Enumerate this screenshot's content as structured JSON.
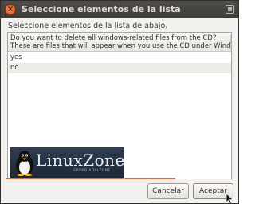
{
  "window": {
    "title": "Seleccione elementos de la lista",
    "close_glyph": "×"
  },
  "dialog": {
    "subtitle": "Seleccione elementos de la lista de abajo."
  },
  "list": {
    "header_lines": [
      "Do you want to delete all windows-related files from the CD?",
      "These are files that will appear when you use the CD under Windows (w"
    ],
    "items": [
      "yes",
      "no"
    ]
  },
  "watermark": {
    "brand": "LinuxZone",
    "tagline": "GRUPO ADSLZONE"
  },
  "buttons": {
    "cancel_label": "Cancelar",
    "accept_label": "Aceptar"
  },
  "colors": {
    "titlebar": "#3c3b37",
    "close_button": "#e9642c",
    "accent_line": "#e36b3a"
  }
}
